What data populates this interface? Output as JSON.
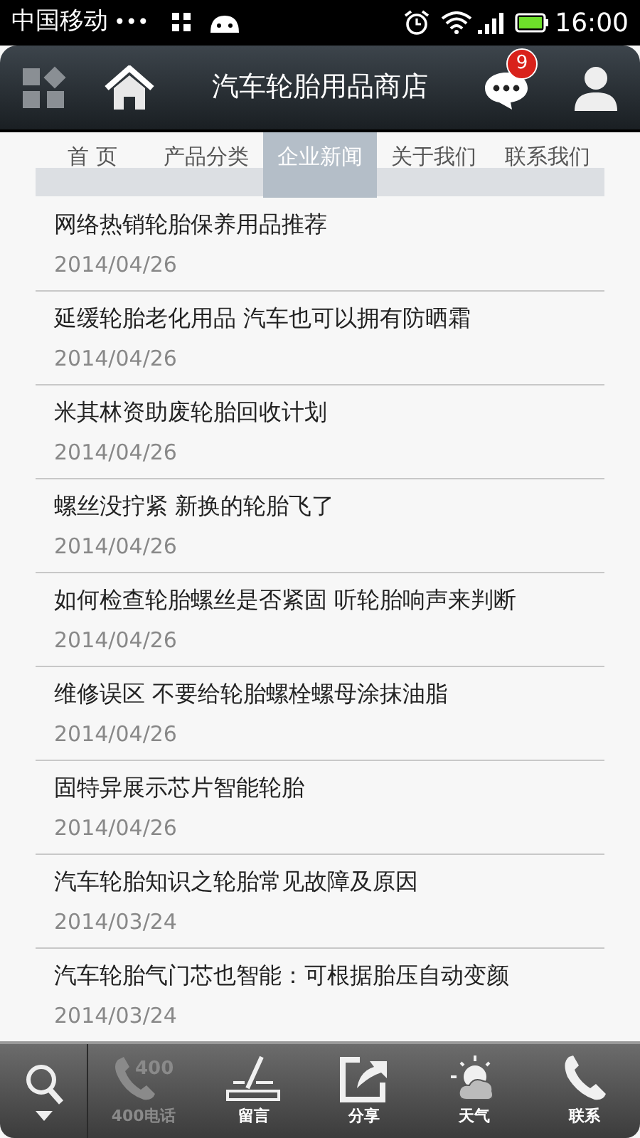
{
  "status_bar": {
    "carrier": "中国移动",
    "dots": "•••",
    "time": "16:00"
  },
  "header": {
    "title": "汽车轮胎用品商店",
    "badge": "9"
  },
  "tabs": [
    {
      "label": "首 页",
      "selected": false
    },
    {
      "label": "产品分类",
      "selected": false
    },
    {
      "label": "企业新闻",
      "selected": true
    },
    {
      "label": "关于我们",
      "selected": false
    },
    {
      "label": "联系我们",
      "selected": false
    }
  ],
  "news": [
    {
      "title": "网络热销轮胎保养用品推荐",
      "date": "2014/04/26"
    },
    {
      "title": "延缓轮胎老化用品 汽车也可以拥有防晒霜",
      "date": "2014/04/26"
    },
    {
      "title": "米其林资助废轮胎回收计划",
      "date": "2014/04/26"
    },
    {
      "title": "螺丝没拧紧 新换的轮胎飞了",
      "date": "2014/04/26"
    },
    {
      "title": "如何检查轮胎螺丝是否紧固 听轮胎响声来判断",
      "date": "2014/04/26"
    },
    {
      "title": "维修误区 不要给轮胎螺栓螺母涂抹油脂",
      "date": "2014/04/26"
    },
    {
      "title": "固特异展示芯片智能轮胎",
      "date": "2014/04/26"
    },
    {
      "title": "汽车轮胎知识之轮胎常见故障及原因",
      "date": "2014/03/24"
    },
    {
      "title": "汽车轮胎气门芯也智能：可根据胎压自动变颜",
      "date": "2014/03/24"
    }
  ],
  "bottom_bar": [
    {
      "kind": "phone400",
      "label": "400电话",
      "icon_text": "400",
      "disabled": true
    },
    {
      "kind": "message",
      "label": "留言",
      "disabled": false
    },
    {
      "kind": "share",
      "label": "分享",
      "disabled": false
    },
    {
      "kind": "weather",
      "label": "天气",
      "disabled": false
    },
    {
      "kind": "phone",
      "label": "联系",
      "disabled": false
    }
  ]
}
